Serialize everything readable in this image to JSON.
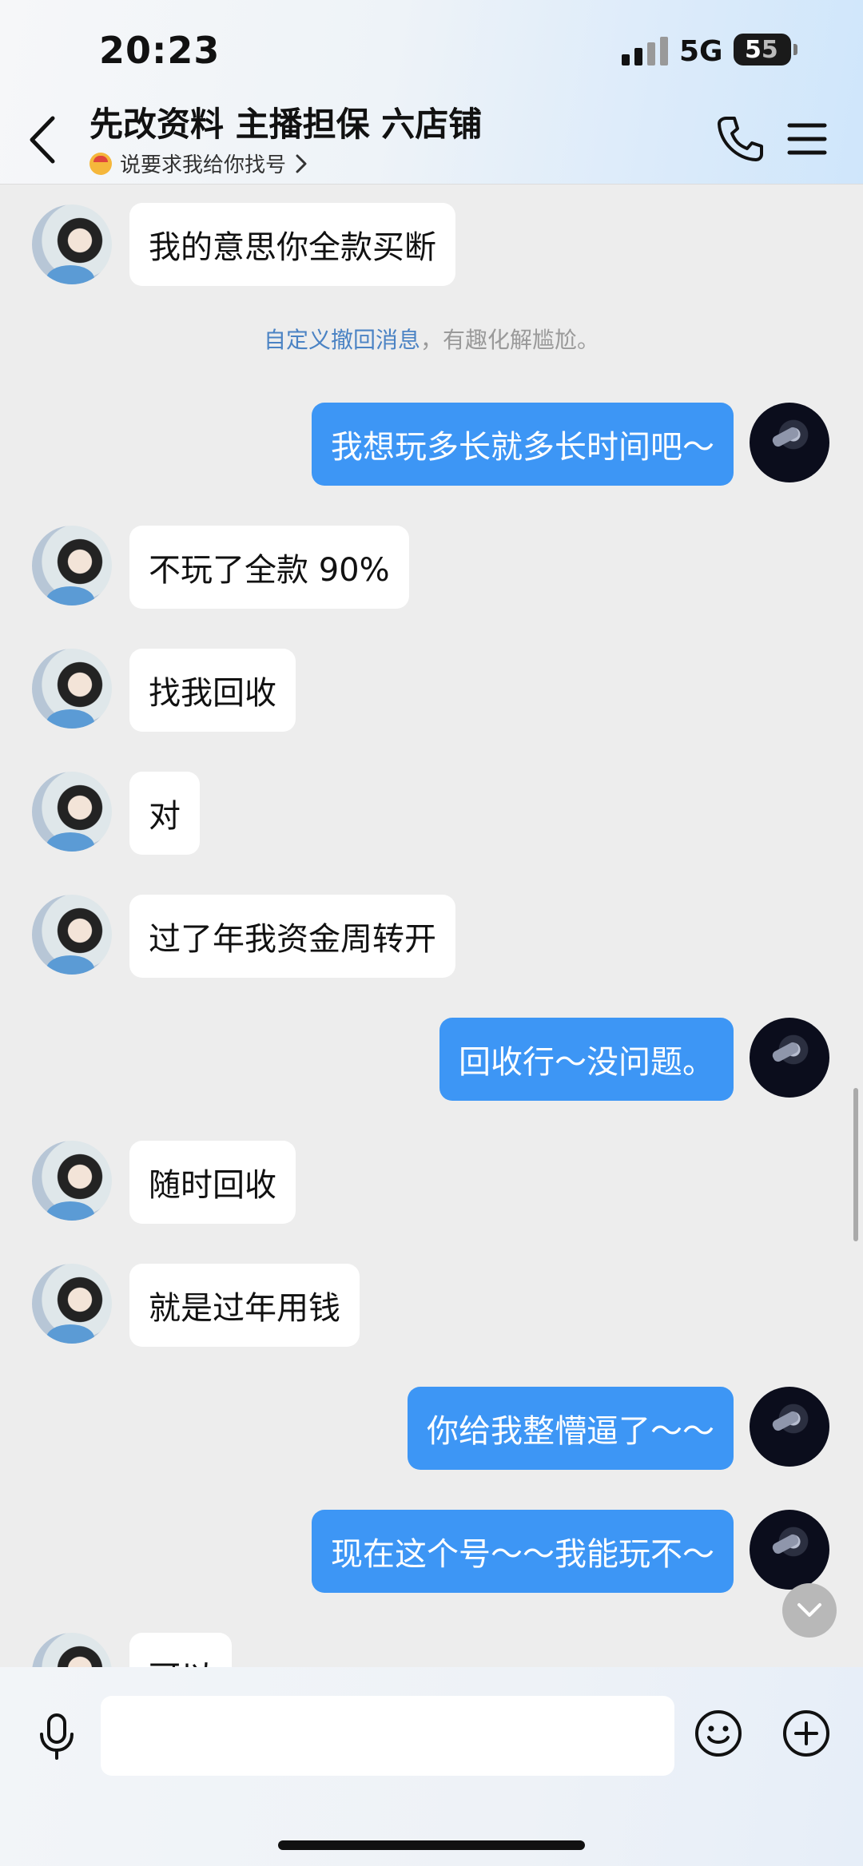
{
  "status_bar": {
    "time": "20:23",
    "network": "5G",
    "battery_a": "5",
    "battery_b": "5"
  },
  "header": {
    "title": "先改资料 主播担保 六店铺",
    "subtitle": "说要求我给你找号",
    "icons": [
      "back-arrow-icon",
      "phone-icon",
      "menu-icon"
    ]
  },
  "system_notice": {
    "link": "自定义撤回消息",
    "text": "，有趣化解尴尬。"
  },
  "messages": [
    {
      "side": "left",
      "text": "我的意思你全款买断"
    },
    {
      "side": "right",
      "text": "我想玩多长就多长时间吧～"
    },
    {
      "side": "left",
      "text": "不玩了全款 90%"
    },
    {
      "side": "left",
      "text": "找我回收"
    },
    {
      "side": "left",
      "text": " 对"
    },
    {
      "side": "left",
      "text": "过了年我资金周转开"
    },
    {
      "side": "right",
      "text": "回收行～没问题。"
    },
    {
      "side": "left",
      "text": "随时回收"
    },
    {
      "side": "left",
      "text": "就是过年用钱"
    },
    {
      "side": "right",
      "text": "你给我整懵逼了～～"
    },
    {
      "side": "right",
      "text": "现在这个号～～我能玩不～"
    },
    {
      "side": "left",
      "text": "可以"
    }
  ],
  "input_bar": {
    "icons": [
      "microphone-icon",
      "emoji-icon",
      "plus-icon"
    ],
    "value": ""
  }
}
